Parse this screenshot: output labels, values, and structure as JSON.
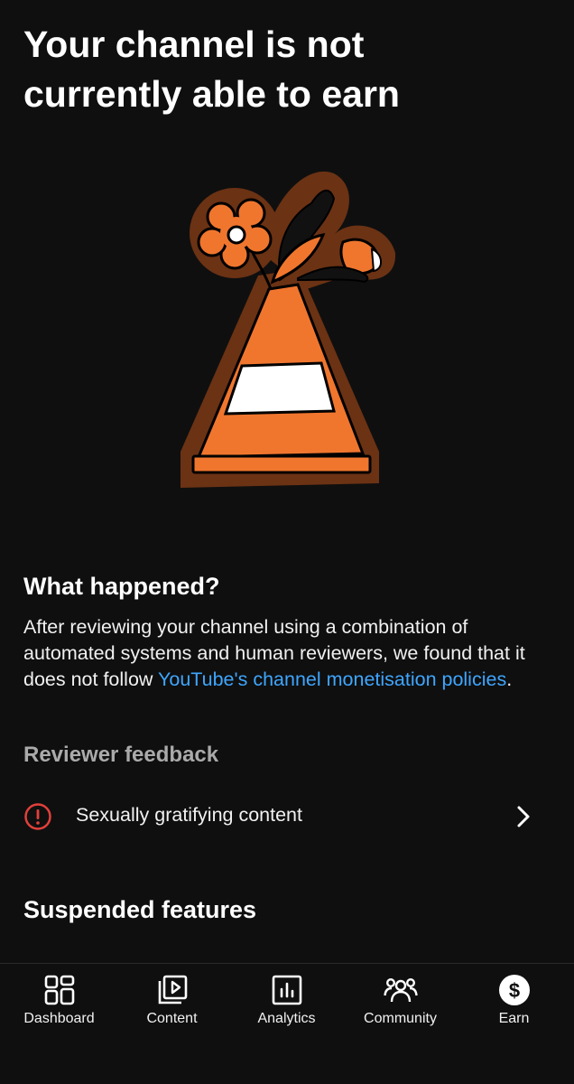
{
  "header": {
    "title": "Your channel is not currently able to earn"
  },
  "illustration": {
    "icon": "traffic-cone-with-flowers-illustration",
    "colors": {
      "cone_orange": "#f0762e",
      "outline_brown": "#6b3214",
      "stripe_white": "#ffffff"
    }
  },
  "what_happened": {
    "heading": "What happened?",
    "text_before": "After reviewing your channel using a combination of automated systems and human reviewers, we found that it does not follow ",
    "link_text": "YouTube's channel monetisation policies",
    "text_after": "."
  },
  "reviewer_feedback": {
    "heading": "Reviewer feedback",
    "items": [
      {
        "label": "Sexually gratifying content",
        "icon": "alert-circle-icon",
        "icon_color": "#e2403a"
      }
    ]
  },
  "suspended": {
    "heading": "Suspended features"
  },
  "bottom_nav": {
    "items": [
      {
        "label": "Dashboard",
        "icon": "dashboard-icon"
      },
      {
        "label": "Content",
        "icon": "content-icon"
      },
      {
        "label": "Analytics",
        "icon": "analytics-icon"
      },
      {
        "label": "Community",
        "icon": "community-icon"
      },
      {
        "label": "Earn",
        "icon": "earn-icon",
        "active": true
      }
    ]
  },
  "colors": {
    "background": "#0f0f0f",
    "link": "#3ea6ff",
    "muted_heading": "#aaaaaa"
  }
}
